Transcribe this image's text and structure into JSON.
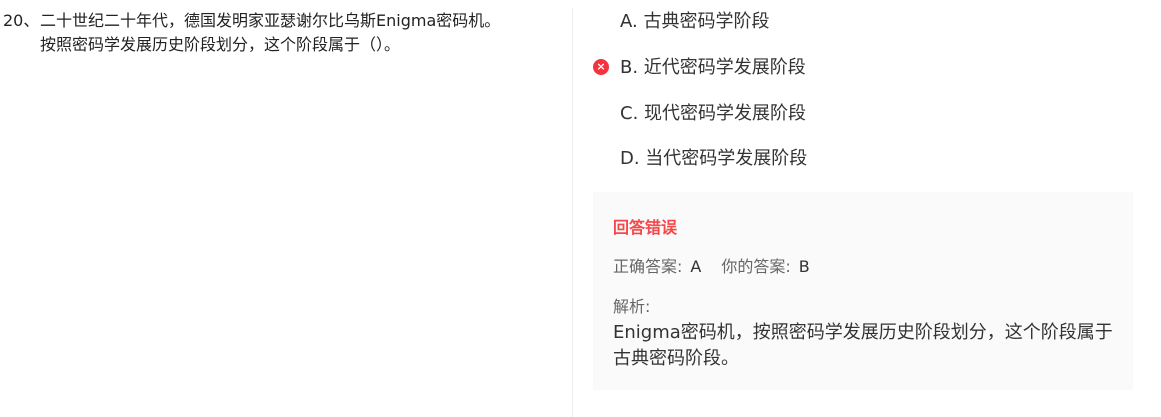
{
  "question": {
    "number": "20、",
    "line1": "二十世纪二十年代，德国发明家亚瑟谢尔比乌斯Enigma密码机。",
    "line2": "按照密码学发展历史阶段划分，这个阶段属于（）。"
  },
  "options": [
    {
      "label": "A. 古典密码学阶段"
    },
    {
      "label": "B. 近代密码学发展阶段",
      "state": "wrong",
      "icon": "close-icon"
    },
    {
      "label": "C. 现代密码学发展阶段"
    },
    {
      "label": "D. 当代密码学发展阶段"
    }
  ],
  "feedback": {
    "title": "回答错误",
    "correct_label": "正确答案:",
    "correct_value": "A",
    "yours_label": "你的答案:",
    "yours_value": "B",
    "analysis_label": "解析:",
    "analysis": "Enigma密码机，按照密码学发展历史阶段划分，这个阶段属于古典密码阶段。"
  },
  "colors": {
    "error": "#f5484a",
    "box_bg": "#fafafa"
  }
}
